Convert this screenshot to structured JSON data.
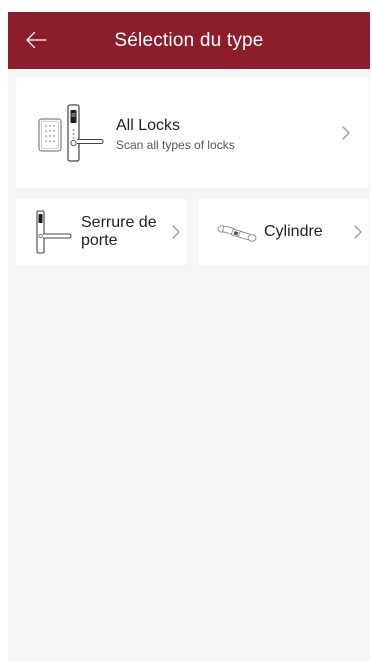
{
  "header": {
    "title": "Sélection du type",
    "background": "#8b1e2a",
    "back_icon": "arrow-left-icon"
  },
  "types": {
    "all": {
      "title": "All Locks",
      "subtitle": "Scan all types of locks",
      "icon": "keypad-door-lock-icon",
      "chevron": "chevron-right-icon"
    },
    "door": {
      "label": "Serrure de porte",
      "icon": "door-handle-lock-icon",
      "chevron": "chevron-right-icon"
    },
    "cylinder": {
      "label": "Cylindre",
      "icon": "cylinder-lock-icon",
      "chevron": "chevron-right-icon"
    }
  }
}
